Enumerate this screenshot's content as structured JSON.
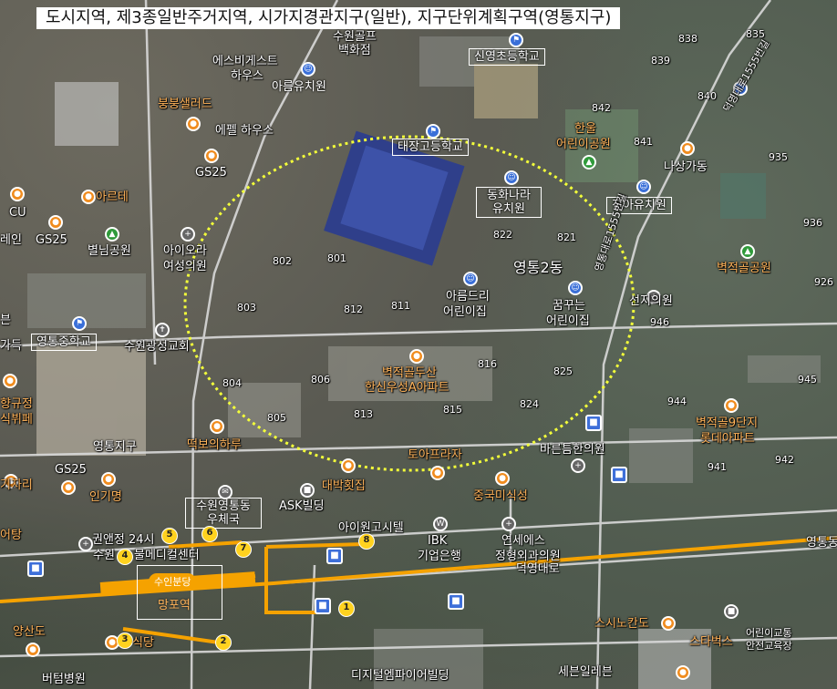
{
  "title": "도시지역, 제3종일반주거지역, 시가지경관지구(일반), 지구단위계획구역(영통지구)",
  "boxed_labels": {
    "sinyoung_school": "신영초등학교",
    "areum_kinder": "아름유치원",
    "taejang_school": "태장고등학교",
    "donghwa_kinder": "동화나라 유치원",
    "jina_kinder": "진아유치원",
    "yeongtong_middle": "영통중학교",
    "yeongtong_post": "수원영통동 우체국",
    "mangpo_station": "망포역"
  },
  "station": {
    "line_badge": "수인분당",
    "name": "망포역"
  },
  "district_label": "영통2동",
  "labels": {
    "suwon_golf": "수원골프",
    "baekhwajeom": "백화점",
    "espi_guest": "에스비게스트",
    "house1": "하우스",
    "bungbung": "붕붕샐러드",
    "epel": "에펠 하우스",
    "gs25_a": "GS25",
    "arte": "아르테",
    "cu": "CU",
    "rain": "레인",
    "gs25_b": "GS25",
    "byeolim_park": "별님공원",
    "aiora": "아이오라",
    "yeoseong": "여성의원",
    "hanul": "한울",
    "hanul2": "어린이공원",
    "nasanggado": "나상가동",
    "byeokjeokgol_park": "벽적골공원",
    "areumdri": "아름드리",
    "areumdri2": "어린이집",
    "kkumkkuneun": "꿈꾸는",
    "kkumkkuneun2": "어린이집",
    "seonji": "선지의원",
    "suwon_church": "수원광성교회",
    "geuk": "가득",
    "hanshin": "벽적골두산",
    "hanshin2": "한신우성A아파트",
    "byeokjeok9": "벽적골9단지",
    "byeokjeok9b": "롯데아파트",
    "yeongtongjigu": "영통지구",
    "tteokbo": "떡보의하루",
    "toa_plaza": "토아프라자",
    "bareun": "바른틈한의원",
    "daebak": "대박횟집",
    "jungguk": "중국미식성",
    "gs25_c": "GS25",
    "ingimyeon": "인기명",
    "gijari": "기자리",
    "sikbupe": "식뷔페",
    "hyangujung": "향규정",
    "ask": "ASK빌딩",
    "aion": "아이원고시텔",
    "ibk": "IBK",
    "ibk2": "기업은행",
    "yeonse": "연세에스",
    "yeonse2": "정형외과의원",
    "gwonaen": "권앤정 24시",
    "suwon_med": "수원",
    "med_center": "물메디컬센터",
    "deogyeong": "덕영대로",
    "yeongtong_right": "영통동",
    "yangsando": "양산도",
    "sikdang": "식당",
    "beodeum": "버텀병원",
    "digital": "디지털엠파이어빌딩",
    "saeburil": "세븐일레븐",
    "seuki": "스시노칸도",
    "starbucks": "스타벅스",
    "children_traffic": "어린이교통",
    "children_traffic2": "안전교육장",
    "road_yeongtong": "영통대로1555번길",
    "road_right": "덕영대로1555번길",
    "eotang": "어탕",
    "nan": "븐"
  },
  "block_numbers": [
    "839",
    "840",
    "842",
    "841",
    "935",
    "936",
    "822",
    "821",
    "802",
    "801",
    "803",
    "812",
    "811",
    "946",
    "926",
    "816",
    "825",
    "945",
    "804",
    "806",
    "815",
    "813",
    "824",
    "944",
    "805",
    "941",
    "942",
    "838",
    "835"
  ],
  "exits": [
    "1",
    "2",
    "3",
    "4",
    "5",
    "6",
    "7",
    "8"
  ],
  "colors": {
    "circle": "#f3ff3a",
    "road_major": "#f5a200",
    "road": "#d9d9d9"
  }
}
